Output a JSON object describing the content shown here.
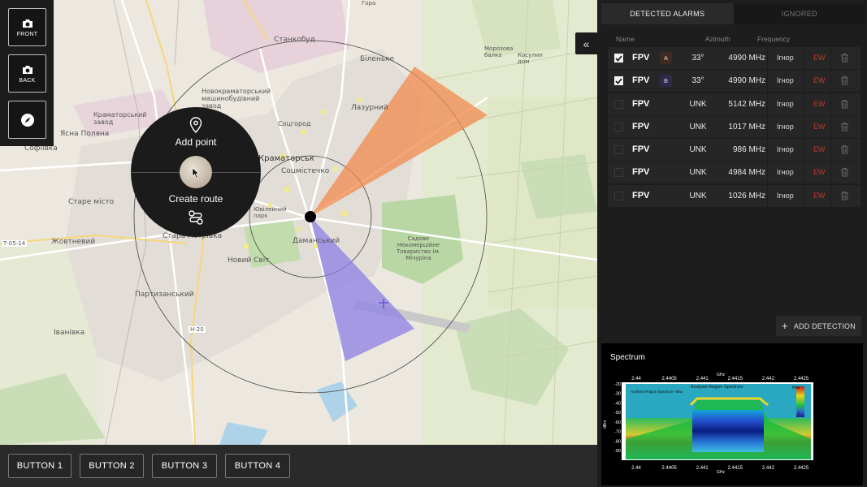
{
  "left_toolbar": {
    "front_label": "FRONT",
    "back_label": "BACK"
  },
  "radial_menu": {
    "add_point_label": "Add point",
    "create_route_label": "Create route"
  },
  "map_labels": {
    "p1": "Станкобуд",
    "p2": "Біленьке",
    "p3": "Новокраматорський машинобудівний завод",
    "p4": "Краматорський завод",
    "p5": "Ясна Поляна",
    "p6": "Софіївка",
    "p7": "Лазурний",
    "p8": "Соцгород",
    "p9": "Соцмістечко",
    "p10": "Старе місто",
    "p11": "Краматорськ",
    "p12": "Даманський",
    "p13": "Стара Петрівка",
    "p14": "Жовтневий",
    "p15": "Новий Світ",
    "p16": "Партизанський",
    "p17": "Іванівка",
    "p18": "Садове Некомерційне Товариство ім. Мічуріна",
    "p19": "Морозова балка",
    "p20": "Косулин дом",
    "p21": "Н-20",
    "p22": "Т-05-14",
    "p23": "Гора",
    "p24": "Ювілейний парк"
  },
  "bottom_bar": {
    "buttons": [
      "BUTTON 1",
      "BUTTON 2",
      "BUTTON 3",
      "BUTTON 4"
    ]
  },
  "panel": {
    "tabs": [
      "DETECTED ALARMS",
      "IGNORED"
    ],
    "columns": {
      "name": "Name",
      "azimuth": "Azimuth",
      "frequency": "Frequency"
    },
    "ignore_label": "Ігнор",
    "ew_label": "EW",
    "alarms": [
      {
        "checked": true,
        "name": "FPV",
        "badge": "A",
        "badge_color": "#3d2a22",
        "azimuth": "33°",
        "frequency": "4990 MHz"
      },
      {
        "checked": true,
        "name": "FPV",
        "badge": "B",
        "badge_color": "#2c2a47",
        "azimuth": "33°",
        "frequency": "4990 MHz"
      },
      {
        "checked": false,
        "name": "FPV",
        "badge": "",
        "badge_color": "",
        "azimuth": "UNK",
        "frequency": "5142 MHz"
      },
      {
        "checked": false,
        "name": "FPV",
        "badge": "",
        "badge_color": "",
        "azimuth": "UNK",
        "frequency": "1017 MHz"
      },
      {
        "checked": false,
        "name": "FPV",
        "badge": "",
        "badge_color": "",
        "azimuth": "UNK",
        "frequency": "986 MHz"
      },
      {
        "checked": false,
        "name": "FPV",
        "badge": "",
        "badge_color": "",
        "azimuth": "UNK",
        "frequency": "4984 MHz"
      },
      {
        "checked": false,
        "name": "FPV",
        "badge": "",
        "badge_color": "",
        "azimuth": "UNK",
        "frequency": "1026 MHz"
      }
    ],
    "add_detection_label": "ADD DETECTION",
    "spectrum": {
      "title": "Spectrum",
      "plot_title": "Analysis Region Spectrum",
      "legend_label": "Analysis Region Spectrum- Max",
      "unit_label": "GHz",
      "y_unit": "dBm",
      "colorbar_label": "Max",
      "colorbar_min": "0",
      "x_ticks": [
        "2.44",
        "2.4405",
        "2.441",
        "2.4415",
        "2.442",
        "2.4425"
      ],
      "y_ticks": [
        "-20",
        "-30",
        "-40",
        "-50",
        "-60",
        "-70",
        "-80",
        "-90"
      ]
    }
  },
  "colors": {
    "orange_sector": "#f2894f",
    "purple_sector": "#8c7fe3",
    "ew": "#c0392b"
  }
}
